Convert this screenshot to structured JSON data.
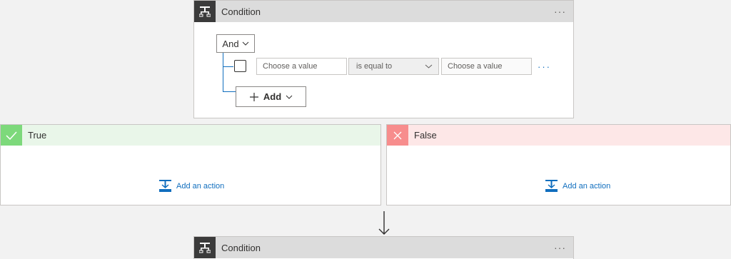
{
  "top_condition": {
    "title": "Condition",
    "more": "···",
    "group_operator": "And",
    "row": {
      "left_placeholder": "Choose a value",
      "operator": "is equal to",
      "right_placeholder": "Choose a value",
      "more": "···"
    },
    "add_label": "Add"
  },
  "true_branch": {
    "title": "True",
    "add_action": "Add an action",
    "color": "#7dd97b"
  },
  "false_branch": {
    "title": "False",
    "add_action": "Add an action",
    "color": "#f78d8d"
  },
  "bottom_condition": {
    "title": "Condition",
    "more": "···"
  }
}
